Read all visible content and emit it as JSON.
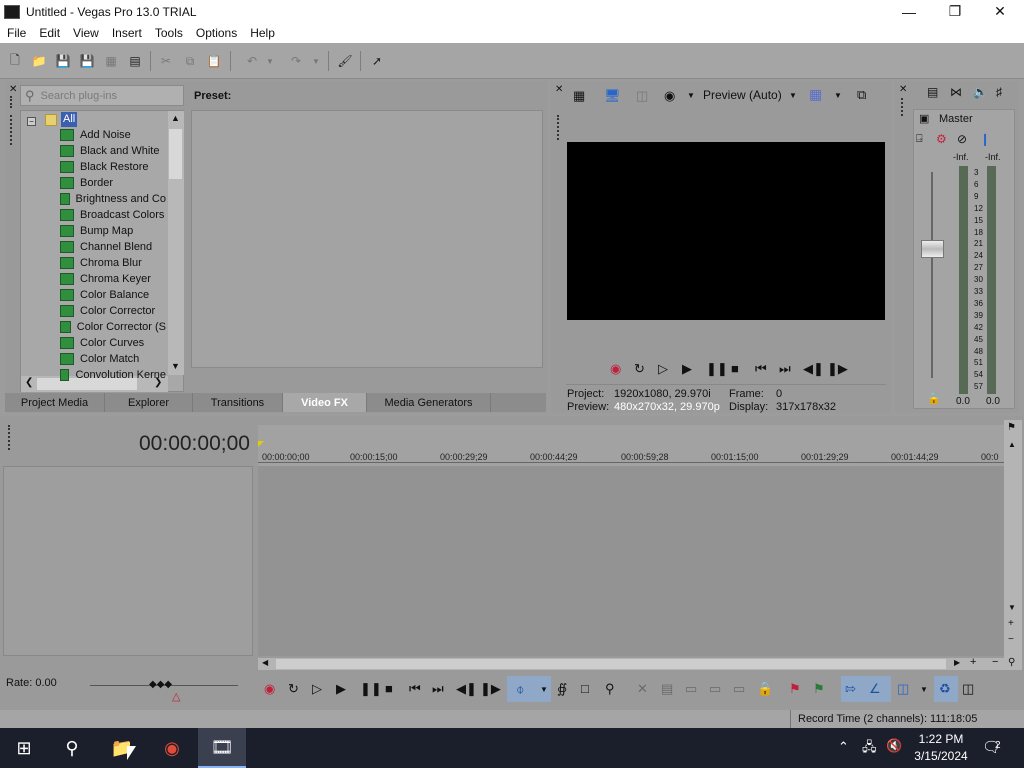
{
  "window": {
    "title": "Untitled - Vegas Pro 13.0 TRIAL"
  },
  "menu": [
    "File",
    "Edit",
    "View",
    "Insert",
    "Tools",
    "Options",
    "Help"
  ],
  "explorer": {
    "search_placeholder": "Search plug-ins",
    "preset_label": "Preset:",
    "root": "All",
    "plugins": [
      "Add Noise",
      "Black and White",
      "Black Restore",
      "Border",
      "Brightness and Co",
      "Broadcast Colors",
      "Bump Map",
      "Channel Blend",
      "Chroma Blur",
      "Chroma Keyer",
      "Color Balance",
      "Color Corrector",
      "Color Corrector (S",
      "Color Curves",
      "Color Match",
      "Convolution Kerne"
    ]
  },
  "tabs": [
    {
      "label": "Project Media",
      "active": false
    },
    {
      "label": "Explorer",
      "active": false
    },
    {
      "label": "Transitions",
      "active": false
    },
    {
      "label": "Video FX",
      "active": true
    },
    {
      "label": "Media Generators",
      "active": false
    }
  ],
  "preview": {
    "mode_label": "Preview (Auto)",
    "project_label": "Project:",
    "project_value": "1920x1080, 29.970i",
    "preview_label": "Preview:",
    "preview_value": "480x270x32, 29.970p",
    "frame_label": "Frame:",
    "frame_value": "0",
    "display_label": "Display:",
    "display_value": "317x178x32"
  },
  "mixer": {
    "title": "Master",
    "inf_left": "-Inf.",
    "inf_right": "-Inf.",
    "scale": [
      "3",
      "6",
      "9",
      "12",
      "15",
      "18",
      "21",
      "24",
      "27",
      "30",
      "33",
      "36",
      "39",
      "42",
      "45",
      "48",
      "51",
      "54",
      "57"
    ],
    "value_left": "0.0",
    "value_right": "0.0"
  },
  "timeline": {
    "timecode": "00:00:00;00",
    "ruler": [
      "00:00:00;00",
      "00:00:15;00",
      "00:00:29;29",
      "00:00:44;29",
      "00:00:59;28",
      "00:01:15;00",
      "00:01:29;29",
      "00:01:44;29",
      "00:0"
    ],
    "rate": "Rate: 0.00"
  },
  "status": {
    "record_time": "Record Time (2 channels): 111:18:05"
  },
  "taskbar": {
    "time": "1:22 PM",
    "date": "3/15/2024",
    "notifications": "2"
  },
  "colors": {
    "accent_active_tab": "#a8a8a8",
    "taskbar": "#1b1f2b"
  }
}
